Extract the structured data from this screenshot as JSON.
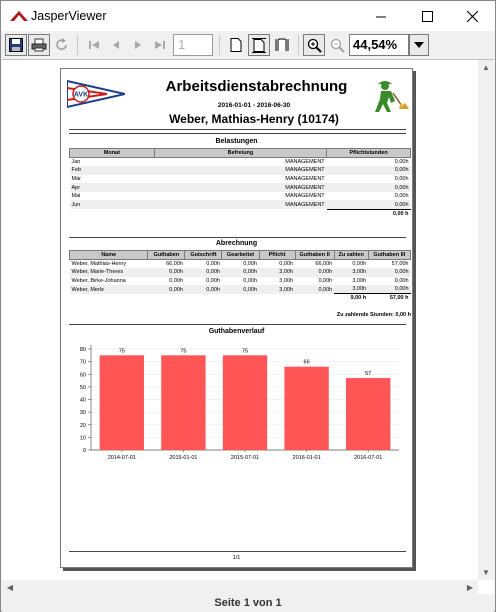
{
  "window": {
    "title": "JasperViewer"
  },
  "toolbar": {
    "page_number": "1",
    "zoom": "44,54%"
  },
  "status_text": "Seite 1 von 1",
  "report": {
    "title": "Arbeitsdienstabrechnung",
    "date_range": "2016-01-01 - 2016-06-30",
    "member": "Weber, Mathias-Henry (10174)",
    "logo_text": "AVK",
    "belastungen": {
      "title": "Belastungen",
      "headers": [
        "Monat",
        "Befreiung",
        "Pflichtstunden"
      ],
      "rows": [
        [
          "Jan",
          "MANAGEMENT",
          "0,00h"
        ],
        [
          "Feb",
          "MANAGEMENT",
          "0,00h"
        ],
        [
          "Mär",
          "MANAGEMENT",
          "0,00h"
        ],
        [
          "Apr",
          "MANAGEMENT",
          "0,00h"
        ],
        [
          "Mai",
          "MANAGEMENT",
          "0,00h"
        ],
        [
          "Jun",
          "MANAGEMENT",
          "0,00h"
        ]
      ],
      "total": "0,00 h"
    },
    "abrechnung": {
      "title": "Abrechnung",
      "headers": [
        "Name",
        "Guthaben",
        "Gutschrift",
        "Gearbeitet",
        "Pflicht",
        "Guthaben II",
        "Zu zahlen",
        "Guthaben III"
      ],
      "rows": [
        [
          "Weber, Mathias-Henry",
          "66,00h",
          "0,00h",
          "0,00h",
          "0,00h",
          "66,00h",
          "0,00h",
          "57,00h"
        ],
        [
          "Weber, Marie-Theres",
          "0,00h",
          "0,00h",
          "0,00h",
          "3,00h",
          "0,00h",
          "3,00h",
          "0,00h"
        ],
        [
          "Weber, Birke-Johanna",
          "0,00h",
          "0,00h",
          "0,00h",
          "3,00h",
          "0,00h",
          "3,00h",
          "0,00h"
        ],
        [
          "Weber, Merle",
          "0,00h",
          "0,00h",
          "0,00h",
          "3,00h",
          "0,00h",
          "3,00h",
          "0,00h"
        ]
      ],
      "total_zu_zahlen": "9,00 h",
      "total_guthaben": "57,00 h",
      "zu_zahlende_label": "Zu zahlende Stunden: 0,00 h"
    },
    "page_footer": "1/1"
  },
  "chart_data": {
    "type": "bar",
    "title": "Guthabenverlauf",
    "categories": [
      "2014-07-01",
      "2015-01-01",
      "2015-07-01",
      "2016-01-01",
      "2016-07-01"
    ],
    "values": [
      75,
      75,
      75,
      66,
      57
    ],
    "ylim": [
      0,
      80
    ],
    "yticks": [
      0,
      10,
      20,
      30,
      40,
      50,
      60,
      70,
      80
    ],
    "bar_color": "#ff5555",
    "grid": true
  }
}
